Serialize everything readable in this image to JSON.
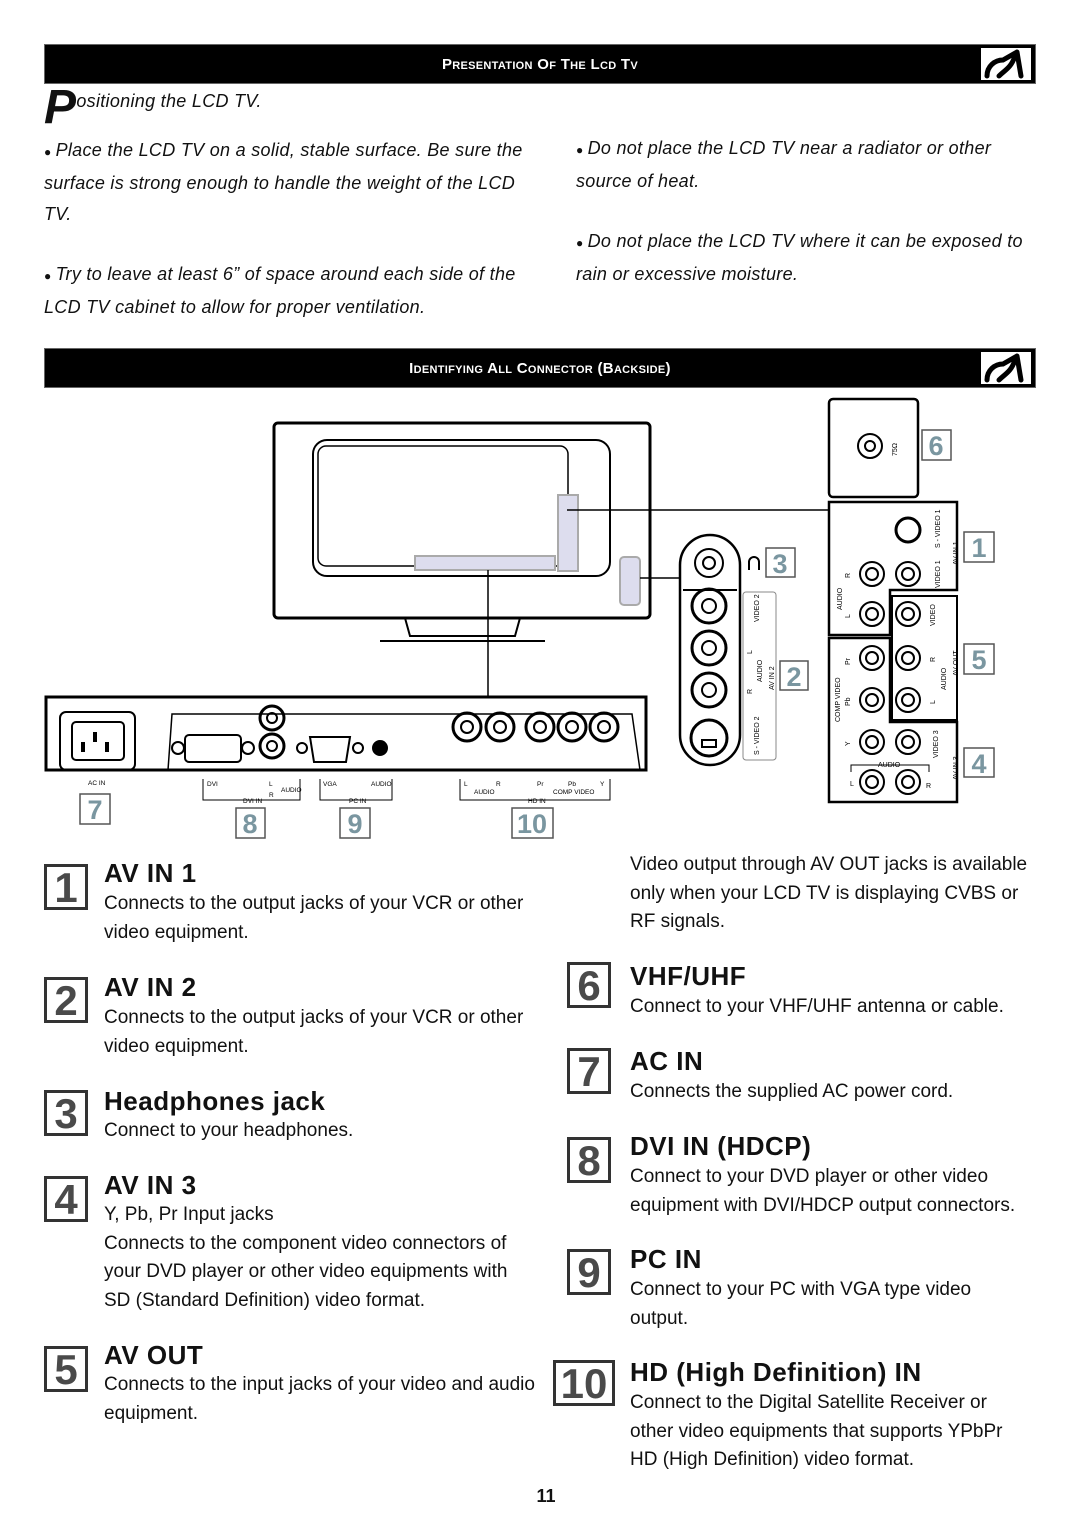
{
  "header1": {
    "title": "Presentation Of The Lcd Tv",
    "icon": "plug-icon"
  },
  "positioning": {
    "drop_cap": "P",
    "heading_rest": "ositioning the LCD TV.",
    "left": [
      "Place the LCD TV on a solid, stable surface. Be sure the surface is strong enough to handle the weight of the LCD TV.",
      "Try to leave at least 6” of space around each side of the LCD TV cabinet to allow for proper ventilation."
    ],
    "right": [
      "Do not place the LCD TV near a radiator or other source of  heat.",
      "Do not place the LCD TV where it can be exposed to rain or excessive moisture."
    ]
  },
  "header2": {
    "title": "Identifying All Connector (Backside)",
    "icon": "plug-icon"
  },
  "diagram": {
    "badge_color": "#7a96a0",
    "back_labels": {
      "ac_in": "AC IN",
      "dvi": "DVI",
      "dvi_l": "L",
      "dvi_r": "R",
      "dvi_audio": "AUDIO",
      "dvi_in": "DVI IN",
      "vga": "VGA",
      "vga_audio": "AUDIO",
      "pc_in": "PC IN",
      "hd_l": "L",
      "hd_r": "R",
      "hd_audio": "AUDIO",
      "hd_pr": "Pr",
      "hd_pb": "Pb",
      "hd_y": "Y",
      "hd_comp": "COMP VIDEO",
      "hd_in": "HD IN"
    },
    "side_labels": {
      "video2": "VIDEO 2",
      "l": "L",
      "audio": "AUDIO",
      "r": "R",
      "av_in2": "AV IN 2",
      "svideo2": "S - VIDEO 2"
    },
    "antenna_label": "75Ω",
    "panel_labels": {
      "svideo1": "S - VIDEO 1",
      "video1": "VIDEO 1",
      "av_in1": "AV IN 1",
      "audio_a": "AUDIO",
      "r_a": "R",
      "l_a": "L",
      "video_out": "VIDEO",
      "r_out": "R",
      "audio_out": "AUDIO",
      "l_out": "L",
      "av_out": "AV OUT",
      "comp_video": "COMP VIDEO",
      "pr": "Pr",
      "pb": "Pb",
      "y": "Y",
      "video3": "VIDEO 3",
      "av_in3": "AV IN 3",
      "audio3": "AUDIO",
      "l3": "L",
      "r3": "R"
    },
    "badges": [
      "1",
      "2",
      "3",
      "4",
      "5",
      "6",
      "7",
      "8",
      "9",
      "10"
    ]
  },
  "sections_left": [
    {
      "num": "1",
      "title": "AV IN 1",
      "lines": [
        "Connects to the output jacks of your VCR or other",
        "video equipment."
      ]
    },
    {
      "num": "2",
      "title": "AV IN 2",
      "lines": [
        "Connects to the output jacks of your VCR or other",
        "video equipment."
      ]
    },
    {
      "num": "3",
      "title": "Headphones jack",
      "lines": [
        "Connect to your headphones."
      ]
    },
    {
      "num": "4",
      "title": "AV IN 3",
      "lines": [
        "Y, Pb, Pr Input jacks",
        "Connects to the component video connectors of",
        "your DVD player or other video equipments with",
        "SD (Standard Definition) video format."
      ]
    },
    {
      "num": "5",
      "title": "AV OUT",
      "lines": [
        "Connects to the input jacks of your video and audio",
        "equipment."
      ]
    }
  ],
  "av_out_note": [
    "Video output through AV OUT jacks is available",
    "only when your LCD TV is displaying CVBS or",
    "RF signals."
  ],
  "sections_right": [
    {
      "num": "6",
      "title": "VHF/UHF",
      "lines": [
        "Connect to your VHF/UHF antenna or cable."
      ]
    },
    {
      "num": "7",
      "title": "AC IN",
      "lines": [
        "Connects the supplied AC power cord."
      ]
    },
    {
      "num": "8",
      "title": "DVI IN (HDCP)",
      "lines": [
        "Connect to your DVD player or other video",
        "equipment with DVI/HDCP output connectors."
      ]
    },
    {
      "num": "9",
      "title": "PC IN",
      "lines": [
        "Connect to your PC with VGA type video",
        "output."
      ]
    },
    {
      "num": "10",
      "title": "HD (High Definition) IN",
      "lines": [
        "Connect to the Digital Satellite Receiver or",
        "other video equipments that supports YPbPr",
        "HD (High Definition) video format."
      ]
    }
  ],
  "page_number": "11"
}
